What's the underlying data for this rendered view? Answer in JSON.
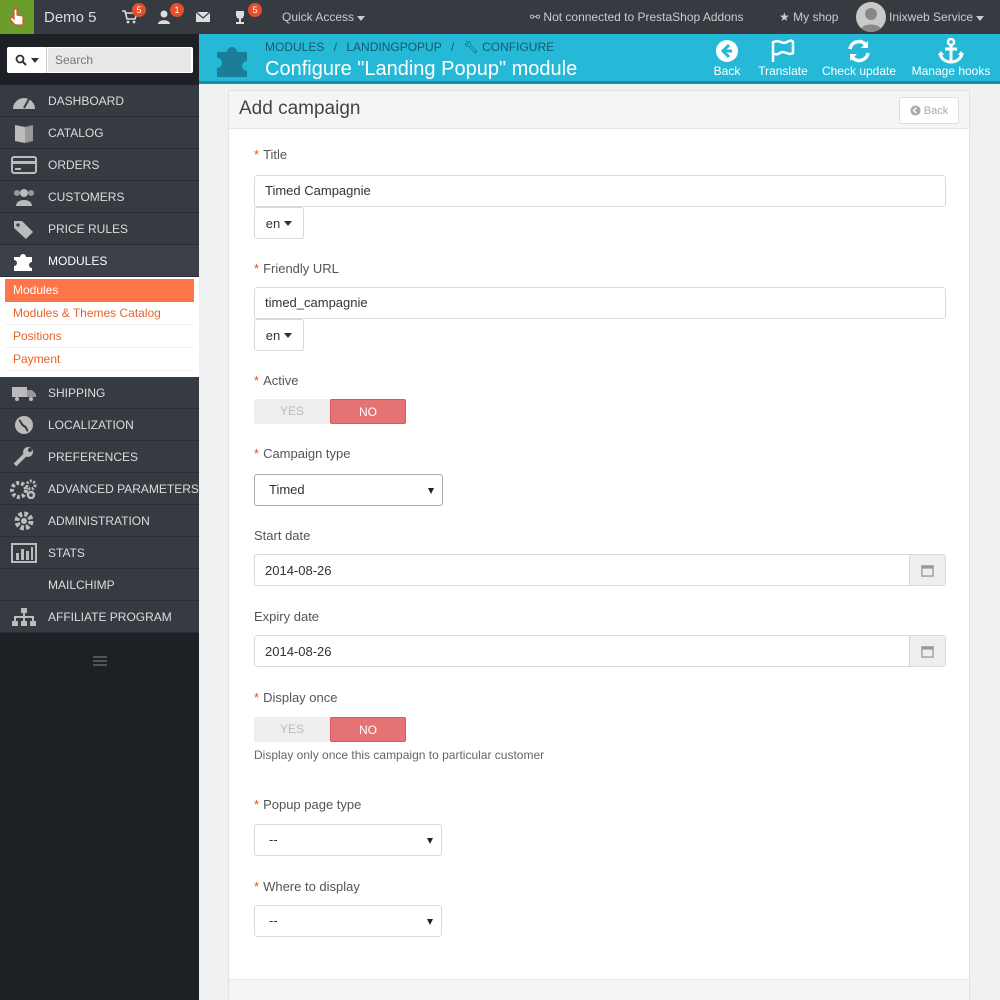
{
  "topbar": {
    "shop_name": "Demo 5",
    "orders_badge": "5",
    "customers_badge": "1",
    "trophy_badge": "5",
    "quick_access": "Quick Access",
    "addons_status": "Not connected to PrestaShop Addons",
    "my_shop": "My shop",
    "user": "Inixweb Service"
  },
  "sidebar": {
    "search_placeholder": "Search",
    "items": [
      {
        "label": "Dashboard",
        "icon": "dashboard-icon"
      },
      {
        "label": "Catalog",
        "icon": "book-icon"
      },
      {
        "label": "Orders",
        "icon": "credit-card-icon"
      },
      {
        "label": "Customers",
        "icon": "users-icon"
      },
      {
        "label": "Price Rules",
        "icon": "tags-icon"
      },
      {
        "label": "Modules",
        "icon": "puzzle-icon"
      }
    ],
    "submenu": [
      "Modules",
      "Modules & Themes Catalog",
      "Positions",
      "Payment"
    ],
    "items2": [
      {
        "label": "Shipping",
        "icon": "truck-icon"
      },
      {
        "label": "Localization",
        "icon": "globe-icon"
      },
      {
        "label": "Preferences",
        "icon": "wrench-icon"
      },
      {
        "label": "Advanced Parameters",
        "icon": "cogs-icon"
      },
      {
        "label": "Administration",
        "icon": "gear-icon"
      },
      {
        "label": "Stats",
        "icon": "bar-chart-icon"
      },
      {
        "label": "Mailchimp",
        "icon": ""
      },
      {
        "label": "Affiliate Program",
        "icon": "sitemap-icon"
      }
    ]
  },
  "header": {
    "breadcrumb_1": "MODULES",
    "breadcrumb_2": "LANDINGPOPUP",
    "breadcrumb_3": "CONFIGURE",
    "title": "Configure \"Landing Popup\" module",
    "buttons": [
      "Back",
      "Translate",
      "Check update",
      "Manage hooks"
    ]
  },
  "form": {
    "panel_title": "Add campaign",
    "back_label": "Back",
    "title_label": "Title",
    "title_value": "Timed Campagnie",
    "lang": "en",
    "url_label": "Friendly URL",
    "url_value": "timed_campagnie",
    "active_label": "Active",
    "yes": "YES",
    "no": "NO",
    "campaign_type_label": "Campaign type",
    "campaign_type_value": "Timed",
    "start_date_label": "Start date",
    "start_date_value": "2014-08-26",
    "expiry_date_label": "Expiry date",
    "expiry_date_value": "2014-08-26",
    "display_once_label": "Display once",
    "display_once_help": "Display only once this campaign to particular customer",
    "popup_page_type_label": "Popup page type",
    "popup_page_type_value": "--",
    "where_label": "Where to display",
    "where_value": "--"
  },
  "colors": {
    "header": "#25b9d7",
    "sidebar": "#363a41",
    "accent": "#ff7548",
    "switch_no": "#e57373"
  }
}
